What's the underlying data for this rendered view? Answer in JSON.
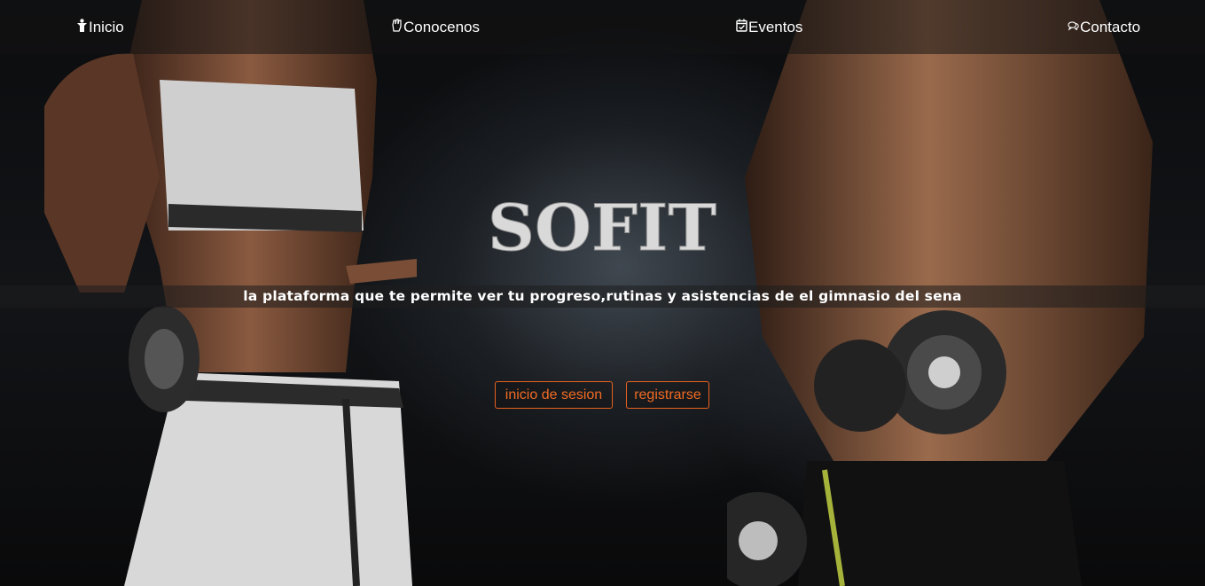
{
  "nav": {
    "items": [
      {
        "label": "Inicio",
        "icon": "person-icon"
      },
      {
        "label": "Conocenos",
        "icon": "hand-icon"
      },
      {
        "label": "Eventos",
        "icon": "calendar-check-icon"
      },
      {
        "label": "Contacto",
        "icon": "chat-bubbles-icon"
      }
    ]
  },
  "hero": {
    "logo_text": "SOFIT",
    "tagline": "la plataforma que te permite ver tu progreso,rutinas y asistencias de el gimnasio del sena",
    "login_label": "inicio de sesion",
    "register_label": "registrarse"
  },
  "colors": {
    "accent": "#e8621f",
    "text": "#ffffff",
    "logo": "#d9d9d9"
  }
}
